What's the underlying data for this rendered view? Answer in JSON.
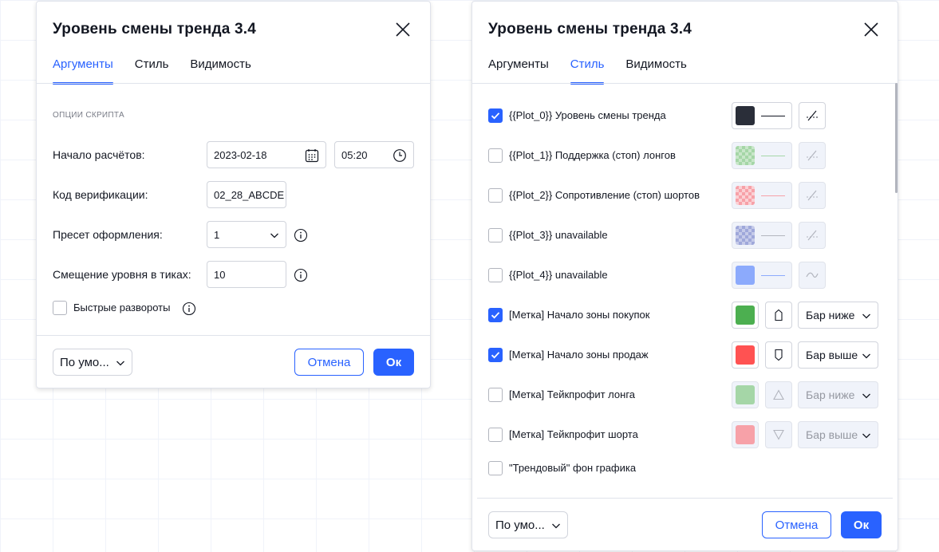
{
  "dialog_args": {
    "title": "Уровень смены тренда 3.4",
    "tabs": [
      "Аргументы",
      "Стиль",
      "Видимость"
    ],
    "section_title": "ОПЦИИ СКРИПТА",
    "rows": {
      "start_label": "Начало расчётов:",
      "start_date": "2023-02-18",
      "start_time": "05:20",
      "code_label": "Код верификации:",
      "code_value": "02_28_ABCDE",
      "preset_label": "Пресет оформления:",
      "preset_value": "1",
      "offset_label": "Смещение уровня в тиках:",
      "offset_value": "10",
      "fast_label": "Быстрые развороты"
    },
    "footer": {
      "defaults": "По умо...",
      "cancel": "Отмена",
      "ok": "Ок"
    }
  },
  "dialog_style": {
    "title": "Уровень смены тренда 3.4",
    "tabs": [
      "Аргументы",
      "Стиль",
      "Видимость"
    ],
    "items": [
      {
        "label": "{{Plot_0}} Уровень смены тренда",
        "checked": true,
        "color": "#2a2e39"
      },
      {
        "label": "{{Plot_1}} Поддержка (стоп) лонгов",
        "checked": false,
        "color": "#4caf50"
      },
      {
        "label": "{{Plot_2}} Сопротивление (стоп) шортов",
        "checked": false,
        "color": "#f23645"
      },
      {
        "label": "{{Plot_3}} unavailable",
        "checked": false,
        "color": "#3f51b5"
      },
      {
        "label": "{{Plot_4}} unavailable",
        "checked": false,
        "color": "#2962ff"
      },
      {
        "label": "[Метка] Начало зоны покупок",
        "checked": true,
        "color": "#4caf50",
        "location": "Бар ниже"
      },
      {
        "label": "[Метка] Начало зоны продаж",
        "checked": true,
        "color": "#ff5252",
        "location": "Бар выше"
      },
      {
        "label": "[Метка] Тейкпрофит лонга",
        "checked": false,
        "color": "#4caf50",
        "location": "Бар ниже"
      },
      {
        "label": "[Метка] Тейкпрофит шорта",
        "checked": false,
        "color": "#f23645",
        "location": "Бар выше"
      },
      {
        "label": "\"Трендовый\" фон графика",
        "checked": false
      }
    ],
    "footer": {
      "defaults": "По умо...",
      "cancel": "Отмена",
      "ok": "Ок"
    }
  },
  "colors": {
    "accent": "#2962ff",
    "text": "#131722",
    "muted": "#787b86",
    "border": "#d1d4dc"
  }
}
